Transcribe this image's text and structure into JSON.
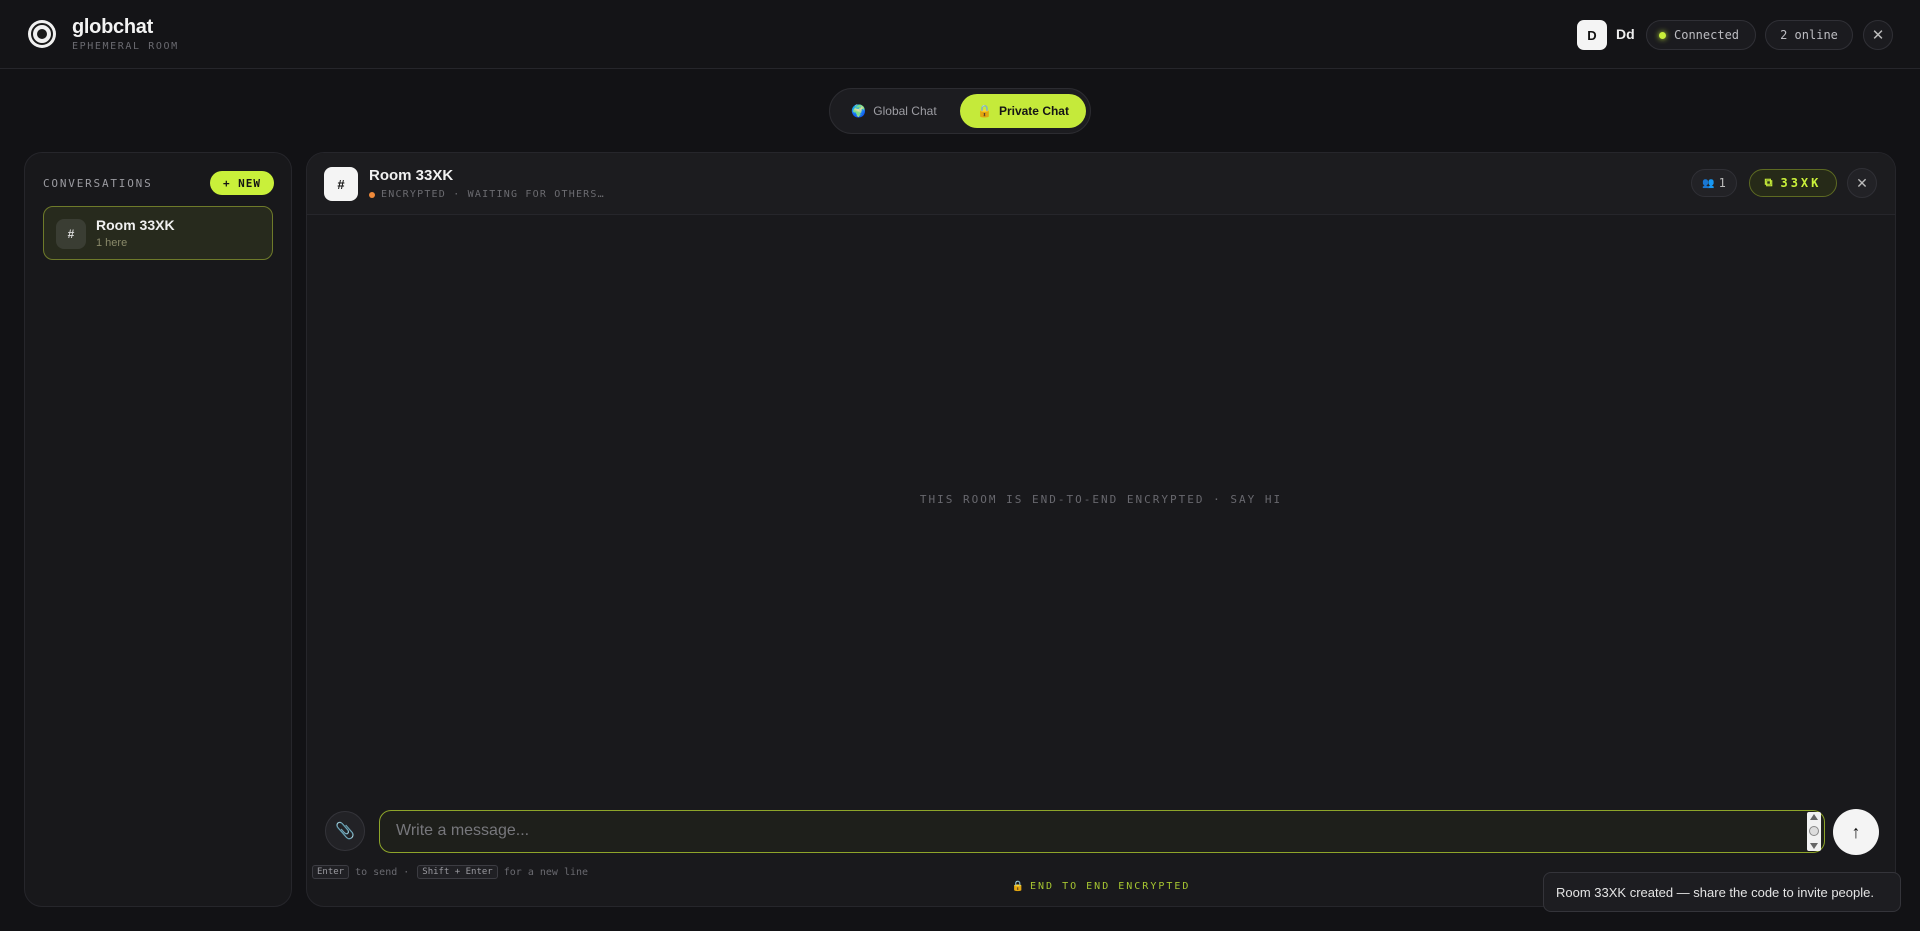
{
  "header": {
    "brand_title": "globchat",
    "brand_subtitle": "EPHEMERAL ROOM",
    "avatar_initial": "D",
    "username": "Dd",
    "connection_status": "Connected",
    "online_count": "2 online",
    "close_label": "✕"
  },
  "mode_switch": {
    "global_label": "Global Chat",
    "global_icon": "globe-icon",
    "private_label": "Private Chat",
    "private_icon": "lock-icon",
    "active": "Private Chat"
  },
  "sidebar": {
    "section_label": "CONVERSATIONS",
    "new_button_label": "+ NEW",
    "items": [
      {
        "icon_text": "#",
        "name": "Room 33XK",
        "meta": "1 here"
      }
    ]
  },
  "chat": {
    "room_icon_text": "#",
    "room_title": "Room 33XK",
    "room_status": "ENCRYPTED · WAITING FOR OTHERS…",
    "members_count": "1",
    "room_code": "33XK",
    "empty_message": "THIS ROOM IS END-TO-END ENCRYPTED · SAY HI",
    "input_placeholder": "Write a message...",
    "input_value": "",
    "hint": {
      "enter_key": "Enter",
      "enter_text": "to send ·",
      "shift_key": "Shift + Enter",
      "shift_text": "for a new line"
    },
    "footer_label": "END TO END ENCRYPTED"
  },
  "toast": {
    "message": "Room 33XK created — share the code to invite people."
  },
  "colors": {
    "accent": "#c9f03a",
    "background": "#121215",
    "status_waiting": "#f08a3a"
  }
}
